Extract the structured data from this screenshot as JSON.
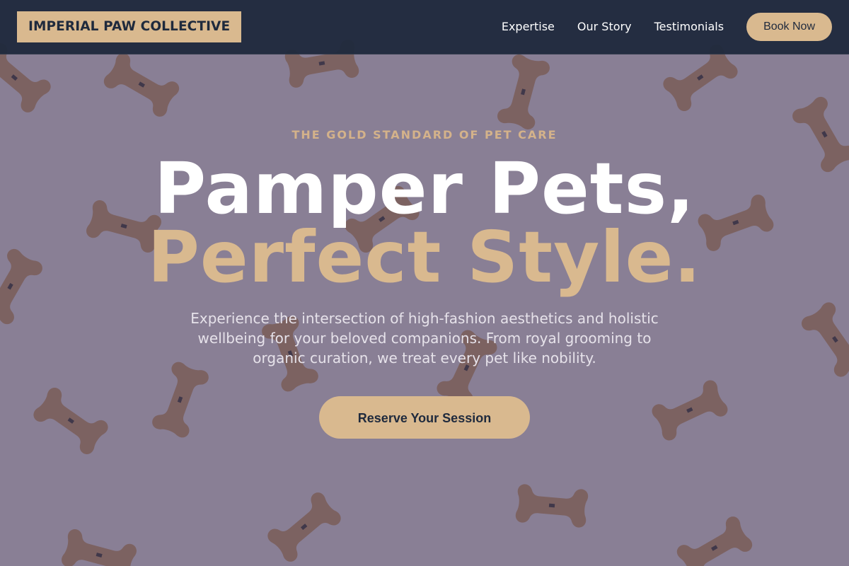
{
  "header": {
    "logo": "IMPERIAL PAW COLLECTIVE",
    "nav": [
      "Expertise",
      "Our Story",
      "Testimonials"
    ],
    "cta": "Book Now"
  },
  "hero": {
    "eyebrow": "THE GOLD STANDARD OF PET CARE",
    "title_line1": "Pamper Pets,",
    "title_line2": "Perfect Style.",
    "description": "Experience the intersection of high-fashion aesthetics and holistic wellbeing for your beloved companions. From royal grooming to organic curation, we treat every pet like nobility.",
    "cta": "Reserve Your Session",
    "background": "bone-shaped dog biscuits scattered on pink surface"
  },
  "colors": {
    "accent": "#d9b98f",
    "header_bg": "#1e283c",
    "text_dark": "#1f2a3d"
  }
}
